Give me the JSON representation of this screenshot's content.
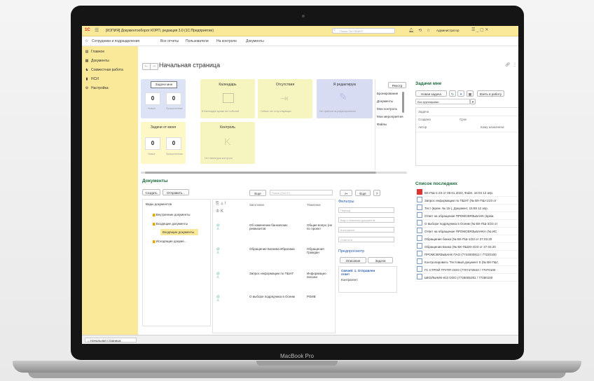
{
  "app": {
    "logo": "1C",
    "title": "[КОПИЯ] Документооборот КОРП, редакция 3.0  (1С:Предприятие)",
    "search_placeholder": "Поиск Ctrl+Shift+F",
    "user": "Администратор",
    "top_icons": [
      "bell-icon",
      "history-icon",
      "star-icon"
    ]
  },
  "nav2": [
    "Сотрудники и подразделения",
    "Все отчеты",
    "Пользователи",
    "На контроле",
    "Документы"
  ],
  "sidebar": [
    {
      "label": "Главное",
      "icon": "menu-icon"
    },
    {
      "label": "Документы",
      "icon": "documents-icon"
    },
    {
      "label": "Совместная работа",
      "icon": "team-icon"
    },
    {
      "label": "НСИ",
      "icon": "book-icon"
    },
    {
      "label": "Настройка",
      "icon": "gear-icon"
    }
  ],
  "page_title": "Начальная страница",
  "tiles": {
    "my_tasks": {
      "title": "Задачи мне",
      "new": "0",
      "overdue": "0",
      "new_label": "Новые",
      "overdue_label": "Просроченные"
    },
    "from_me": {
      "title": "Задачи от меня",
      "new": "0",
      "overdue": "0",
      "new_label": "Новые",
      "overdue_label": "Просроченные"
    },
    "calendar": {
      "title": "Календарь",
      "note": "В Календаре время нет событий"
    },
    "absent": {
      "title": "Отсутствия",
      "note": "Сейчас нет отсутствующих"
    },
    "editing": {
      "title": "Я редактирую",
      "note": "Нет файлов на редактировании"
    },
    "control": {
      "title": "Контроль",
      "note": "Нет писем для контроля"
    }
  },
  "registry": {
    "tab": "Реестр",
    "items": [
      "Бронирование",
      "Документы",
      "Мои контроль",
      "Мои мероприятия",
      "Файлы"
    ]
  },
  "tasks_panel": {
    "title": "Задачи мне",
    "new_task": "Новая задача",
    "take_work": "Взять в работу",
    "grouping": "Без группировки",
    "col_task": "Задача",
    "col_created": "Создана",
    "col_deadline": "Срок",
    "col_author": "Автор",
    "col_assigned": "Кому назначена"
  },
  "docs": {
    "title": "Документы",
    "create": "Создать",
    "send": "Отправить...",
    "more": "Еще",
    "search_placeholder": "Поиск (Ctrl+F)",
    "more2": "Еще",
    "help": "?",
    "tree": [
      "Виды документов",
      "Внутренние документы",
      "Входящие документы",
      "Входящие документы",
      "Исходящие докуме..."
    ],
    "col_header": "Заголовок",
    "col_subject": "Тематика",
    "rows": [
      {
        "title": "Об изменении банковских реквизитов",
        "subject": "Общие вопро (не по проект"
      },
      {
        "title": "Обращение Багаева Ибрагима",
        "subject": "Обращения Граждан"
      },
      {
        "title": "Запрос информации по ПШАТ",
        "subject": "Информацио письмо"
      },
      {
        "title": "О выборе подрядчика в Осеим",
        "subject": "РОИВ"
      }
    ],
    "filters": "Фильтры",
    "f_state": "Период",
    "f_doc": "Вид и тематика документа",
    "f_org": "Контрагент",
    "f_resp": "Ответств",
    "preview": "Предпросмотр",
    "tab_desc": "Описание",
    "tab_tasks": "Задачи",
    "link": "Связей: 1. Отправлен ответ",
    "kontragent": "Контрагент:"
  },
  "recent": {
    "title": "Список последних",
    "items": [
      "ВХ-ПШ-1-23 от 09.01.2023, Файл, 16:04 12 апр.",
      "Запрос информации по ПШАТ (№ ВХ-ПШ-1/23 от",
      "Тест (врем. № 15-), Документ, 15:59 12 апр.",
      "Ответ на обращение ПРОМСВЯЗЬБАНК (врем.",
      "О выборе подрядчика в Осеим (№ ВХ-ПШ-3/23 от",
      "Ответ на обращение ПРОМСВЯЗЬБАНКА (№ ИС",
      "Обращение банка (№ ВХ-ПШ-1/23 от 27.03.20",
      "Обращение Банка (№ ВХ-ПШ20-2/23 от 27.03.20",
      "ПРОМСВЯЗЬБАНК ПАО (7744000912 / 77220100",
      "Контролировать 'Тестовый документ 5 (№ ВХ-ПШ',",
      "ГС СТРОЙ ГРУПП ООО (7707472843 / 77070100",
      "ШКОЛЬНИК-ЮЗ ООО (7728005281 / 77280100"
    ]
  },
  "bottom_tab": "Начальная страница",
  "device_label": "MacBook Pro",
  "colors": {
    "panel_yellow": "#fbe99a",
    "section_green": "#1a6a3c",
    "tile_blue": "#dde3f7"
  }
}
